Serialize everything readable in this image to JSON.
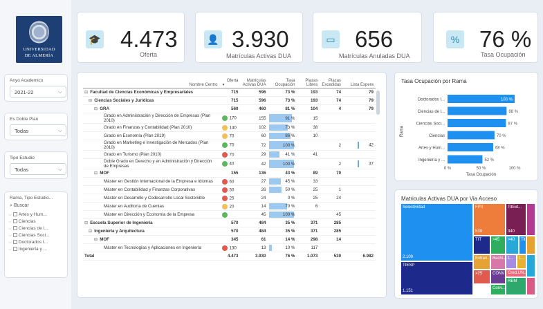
{
  "logo": {
    "line1": "UNIVERSIDAD",
    "line2": "DE ALMERÍA"
  },
  "kpis": [
    {
      "icon": "graduation-cap-icon",
      "value": "4.473",
      "label": "Oferta"
    },
    {
      "icon": "student-icon",
      "value": "3.930",
      "label": "Matrículas Activas DUA"
    },
    {
      "icon": "wallet-icon",
      "value": "656",
      "label": "Matrículas Anuladas DUA"
    },
    {
      "icon": "percent-icon",
      "value": "76 %",
      "label": "Tasa Ocupación"
    }
  ],
  "filters": {
    "year": {
      "title": "Anyo Academico",
      "value": "2021-22"
    },
    "doble": {
      "title": "Es Doble Plan",
      "value": "Todas"
    },
    "tipo": {
      "title": "Tipo Estudio",
      "value": "Todas"
    },
    "rama": {
      "title": "Rama, Tipo Estudio...",
      "search": "Buscar",
      "items": [
        "Artes y Hum...",
        "Ciencias",
        "Ciencias de l...",
        "Ciencias Soci...",
        "Doctorados I...",
        "Ingeniería y ..."
      ]
    }
  },
  "table": {
    "headers": [
      "Nombre Centro",
      "Oferta",
      "Matrículas Activas DUA",
      "Tasa Ocupación",
      "Plazas Libres",
      "Plazas Excedidas",
      "Lista Espera"
    ],
    "rows": [
      {
        "name": "Facultad de Ciencias Económicas y Empresariales",
        "lvl": 0,
        "exp": "⊟",
        "bold": true,
        "c": [
          "715",
          "596",
          "73 %",
          "193",
          "74",
          "79"
        ]
      },
      {
        "name": "Ciencias Sociales y Jurídicas",
        "lvl": 1,
        "exp": "⊟",
        "bold": true,
        "c": [
          "715",
          "596",
          "73 %",
          "193",
          "74",
          "79"
        ]
      },
      {
        "name": "GRA",
        "lvl": 2,
        "exp": "⊟",
        "bold": true,
        "c": [
          "560",
          "460",
          "81 %",
          "104",
          "4",
          "79"
        ]
      },
      {
        "name": "Grado en Administración y Dirección de Empresas (Plan 2010)",
        "lvl": 3,
        "dot": "#5cb85c",
        "c": [
          "170",
          "155",
          "91 %",
          "15",
          "",
          ""
        ],
        "pct": 91
      },
      {
        "name": "Grado en Finanzas y Contabilidad (Plan 2010)",
        "lvl": 3,
        "dot": "#f0c05a",
        "c": [
          "140",
          "102",
          "73 %",
          "38",
          "",
          ""
        ],
        "pct": 73
      },
      {
        "name": "Grado en Economía (Plan 2019)",
        "lvl": 3,
        "dot": "#f0c05a",
        "c": [
          "70",
          "60",
          "86 %",
          "10",
          "",
          ""
        ],
        "pct": 86
      },
      {
        "name": "Grado en Marketing e Investigación de Mercados (Plan 2010)",
        "lvl": 3,
        "dot": "#5cb85c",
        "c": [
          "70",
          "72",
          "100 %",
          "",
          "2",
          "42"
        ],
        "pct": 100
      },
      {
        "name": "Grado en Turismo (Plan 2010)",
        "lvl": 3,
        "dot": "#e05a4e",
        "c": [
          "70",
          "29",
          "41 %",
          "41",
          "",
          ""
        ],
        "pct": 41
      },
      {
        "name": "Doble Grado en Derecho y en Administración y Dirección de Empresas",
        "lvl": 3,
        "dot": "#5cb85c",
        "c": [
          "40",
          "42",
          "100 %",
          "",
          "2",
          "37"
        ],
        "pct": 100
      },
      {
        "name": "MOF",
        "lvl": 2,
        "exp": "⊟",
        "bold": true,
        "c": [
          "155",
          "136",
          "43 %",
          "89",
          "70",
          ""
        ]
      },
      {
        "name": "Máster en Gestión Internacional de la Empresa e Idiomas",
        "lvl": 3,
        "dot": "#e05a4e",
        "c": [
          "60",
          "27",
          "45 %",
          "33",
          "",
          ""
        ],
        "pct": 45
      },
      {
        "name": "Máster en Contabilidad y Finanzas Corporativas",
        "lvl": 3,
        "dot": "#e05a4e",
        "c": [
          "50",
          "26",
          "50 %",
          "25",
          "1",
          ""
        ],
        "pct": 50
      },
      {
        "name": "Máster en Desarrollo y Codesarrollo Local Sostenible",
        "lvl": 3,
        "dot": "#e05a4e",
        "c": [
          "25",
          "24",
          "0 %",
          "25",
          "24",
          ""
        ],
        "pct": 0
      },
      {
        "name": "Máster en Auditoría de Cuentas",
        "lvl": 3,
        "dot": "#f0c05a",
        "c": [
          "20",
          "14",
          "70 %",
          "6",
          "",
          ""
        ],
        "pct": 70
      },
      {
        "name": "Máster en Dirección y Economía de la Empresa",
        "lvl": 3,
        "dot": "#5cb85c",
        "c": [
          "",
          "45",
          "100 %",
          "",
          "45",
          ""
        ],
        "pct": 100
      },
      {
        "name": "Escuela Superior de Ingeniería",
        "lvl": 0,
        "exp": "⊟",
        "bold": true,
        "c": [
          "570",
          "484",
          "35 %",
          "371",
          "285",
          ""
        ]
      },
      {
        "name": "Ingeniería y Arquitectura",
        "lvl": 1,
        "exp": "⊟",
        "bold": true,
        "c": [
          "570",
          "484",
          "35 %",
          "371",
          "285",
          ""
        ]
      },
      {
        "name": "MOF",
        "lvl": 2,
        "exp": "⊟",
        "bold": true,
        "c": [
          "345",
          "61",
          "14 %",
          "298",
          "14",
          ""
        ]
      },
      {
        "name": "Máster en Tecnologías y Aplicaciones en Ingeniería",
        "lvl": 3,
        "dot": "#e05a4e",
        "c": [
          "130",
          "13",
          "10 %",
          "117",
          "",
          ""
        ],
        "pct": 10
      },
      {
        "name": "Total",
        "lvl": 0,
        "bold": true,
        "total": true,
        "c": [
          "4.473",
          "3.930",
          "76 %",
          "1.073",
          "530",
          "6.982"
        ]
      }
    ]
  },
  "rama_chart": {
    "title": "Tasa Ocupación por Rama",
    "ylabel": "Rama",
    "xlabel": "Tasa Ocupación",
    "ticks": [
      "0 %",
      "50 %",
      "100 %"
    ]
  },
  "chart_data": [
    {
      "type": "bar",
      "title": "Tasa Ocupación por Rama",
      "categories": [
        "Doctorados I...",
        "Ciencias de l...",
        "Ciencias Soci...",
        "Ciencias",
        "Artes y Hum...",
        "Ingeniería y ..."
      ],
      "values": [
        100,
        88,
        87,
        70,
        68,
        52
      ],
      "labels": [
        "100 %",
        "88 %",
        "87 %",
        "70 %",
        "68 %",
        "52 %"
      ],
      "xlabel": "Tasa Ocupación",
      "ylabel": "Rama",
      "xlim": [
        0,
        100
      ]
    },
    {
      "type": "treemap",
      "title": "Matriculas Activas DUA por Via Acceso",
      "items": [
        {
          "name": "Selectividad",
          "value": 2109,
          "label": "2.109"
        },
        {
          "name": "TIESP",
          "value": 1151,
          "label": "1.151"
        },
        {
          "name": "FPII",
          "value": 539,
          "label": "539"
        },
        {
          "name": "TitExt...",
          "value": 340,
          "label": "340"
        },
        {
          "name": "TIT"
        },
        {
          "name": ">45"
        },
        {
          "name": ">40"
        },
        {
          "name": "Tit..."
        },
        {
          "name": "Extran..."
        },
        {
          "name": "Bachi..."
        },
        {
          "name": ">25"
        },
        {
          "name": "CONV"
        },
        {
          "name": "1..."
        },
        {
          "name": "1..."
        },
        {
          "name": "Cred.UN..."
        },
        {
          "name": "Conv..."
        },
        {
          "name": "REM"
        }
      ]
    }
  ]
}
